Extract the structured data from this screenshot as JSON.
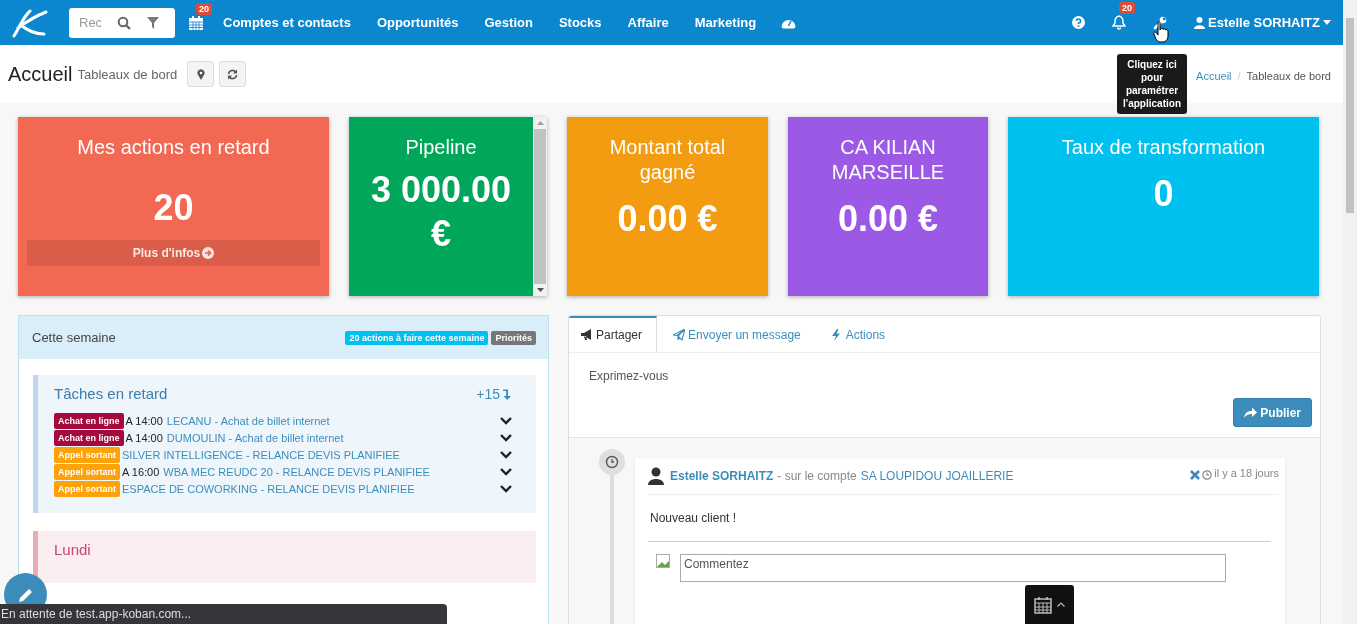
{
  "navbar": {
    "search_placeholder": "Rec",
    "calendar_badge": "20",
    "menu": [
      "Comptes et contacts",
      "Opportunités",
      "Gestion",
      "Stocks",
      "Affaire",
      "Marketing"
    ],
    "notification_badge": "20",
    "user": "Estelle SORHAITZ"
  },
  "tooltip": "Cliquez ici pour paramétrer l'application",
  "header": {
    "title": "Accueil",
    "subtitle": "Tableaux de bord",
    "breadcrumb": [
      "Accueil",
      "Tableaux de bord"
    ],
    "breadcrumb_separator": "/"
  },
  "tiles": [
    {
      "title": "Mes actions en retard",
      "value": "20",
      "color": "#f26852",
      "link": "Plus d'infos"
    },
    {
      "title": "Pipeline",
      "value": "3 000.00 €",
      "color": "#00a65a",
      "kind": "scroll"
    },
    {
      "title": "Montant total gagné",
      "value": "0.00 €",
      "color": "#f39c12"
    },
    {
      "title": "CA KILIAN MARSEILLE",
      "value": "0.00 €",
      "color": "#9b59e6"
    },
    {
      "title": "Taux de transformation",
      "value": "0",
      "color": "#00c0ef"
    }
  ],
  "week_panel": {
    "title": "Cette semaine",
    "badges": [
      {
        "label": "20 actions à faire cette semaine",
        "color": "#00c0ef"
      },
      {
        "label": "Priorités",
        "color": "#777777"
      }
    ],
    "sections": [
      {
        "kind": "late",
        "title": "Tâches en retard",
        "count": "+15",
        "tasks": [
          {
            "tag": "Achat en ligne",
            "color": "#a50a3c",
            "time": "A 14:00",
            "text": "LECANU - Achat de billet internet"
          },
          {
            "tag": "Achat en ligne",
            "color": "#a50a3c",
            "time": "A 14:00",
            "text": "DUMOULIN - Achat de billet internet"
          },
          {
            "tag": "Appel sortant",
            "color": "#fea20a",
            "text": "SILVER INTELLIGENCE - RELANCE DEVIS PLANIFIEE"
          },
          {
            "tag": "Appel sortant",
            "color": "#fea20a",
            "time": "A 16:00",
            "text": "WBA MEC REUDC 20 - RELANCE DEVIS PLANIFIEE"
          },
          {
            "tag": "Appel sortant",
            "color": "#fea20a",
            "text": "ESPACE DE COWORKING - RELANCE DEVIS PLANIFIEE"
          }
        ]
      },
      {
        "kind": "day",
        "title": "Lundi"
      }
    ]
  },
  "feed": {
    "tabs": [
      {
        "label": "Partager",
        "selected": true
      },
      {
        "label": "Envoyer un message",
        "selected": false
      },
      {
        "label": "Actions",
        "selected": false
      }
    ],
    "placeholder": "Exprimez-vous",
    "publish": "Publier",
    "posts": [
      {
        "author": "Estelle SORHAITZ",
        "context": "- sur le compte",
        "account": "SA LOUPIDOU JOAILLERIE",
        "time": "il y a 18 jours",
        "body": "Nouveau client !",
        "comment_placeholder": "Commentez"
      }
    ]
  },
  "status_text": "En attente de test.app-koban.com..."
}
